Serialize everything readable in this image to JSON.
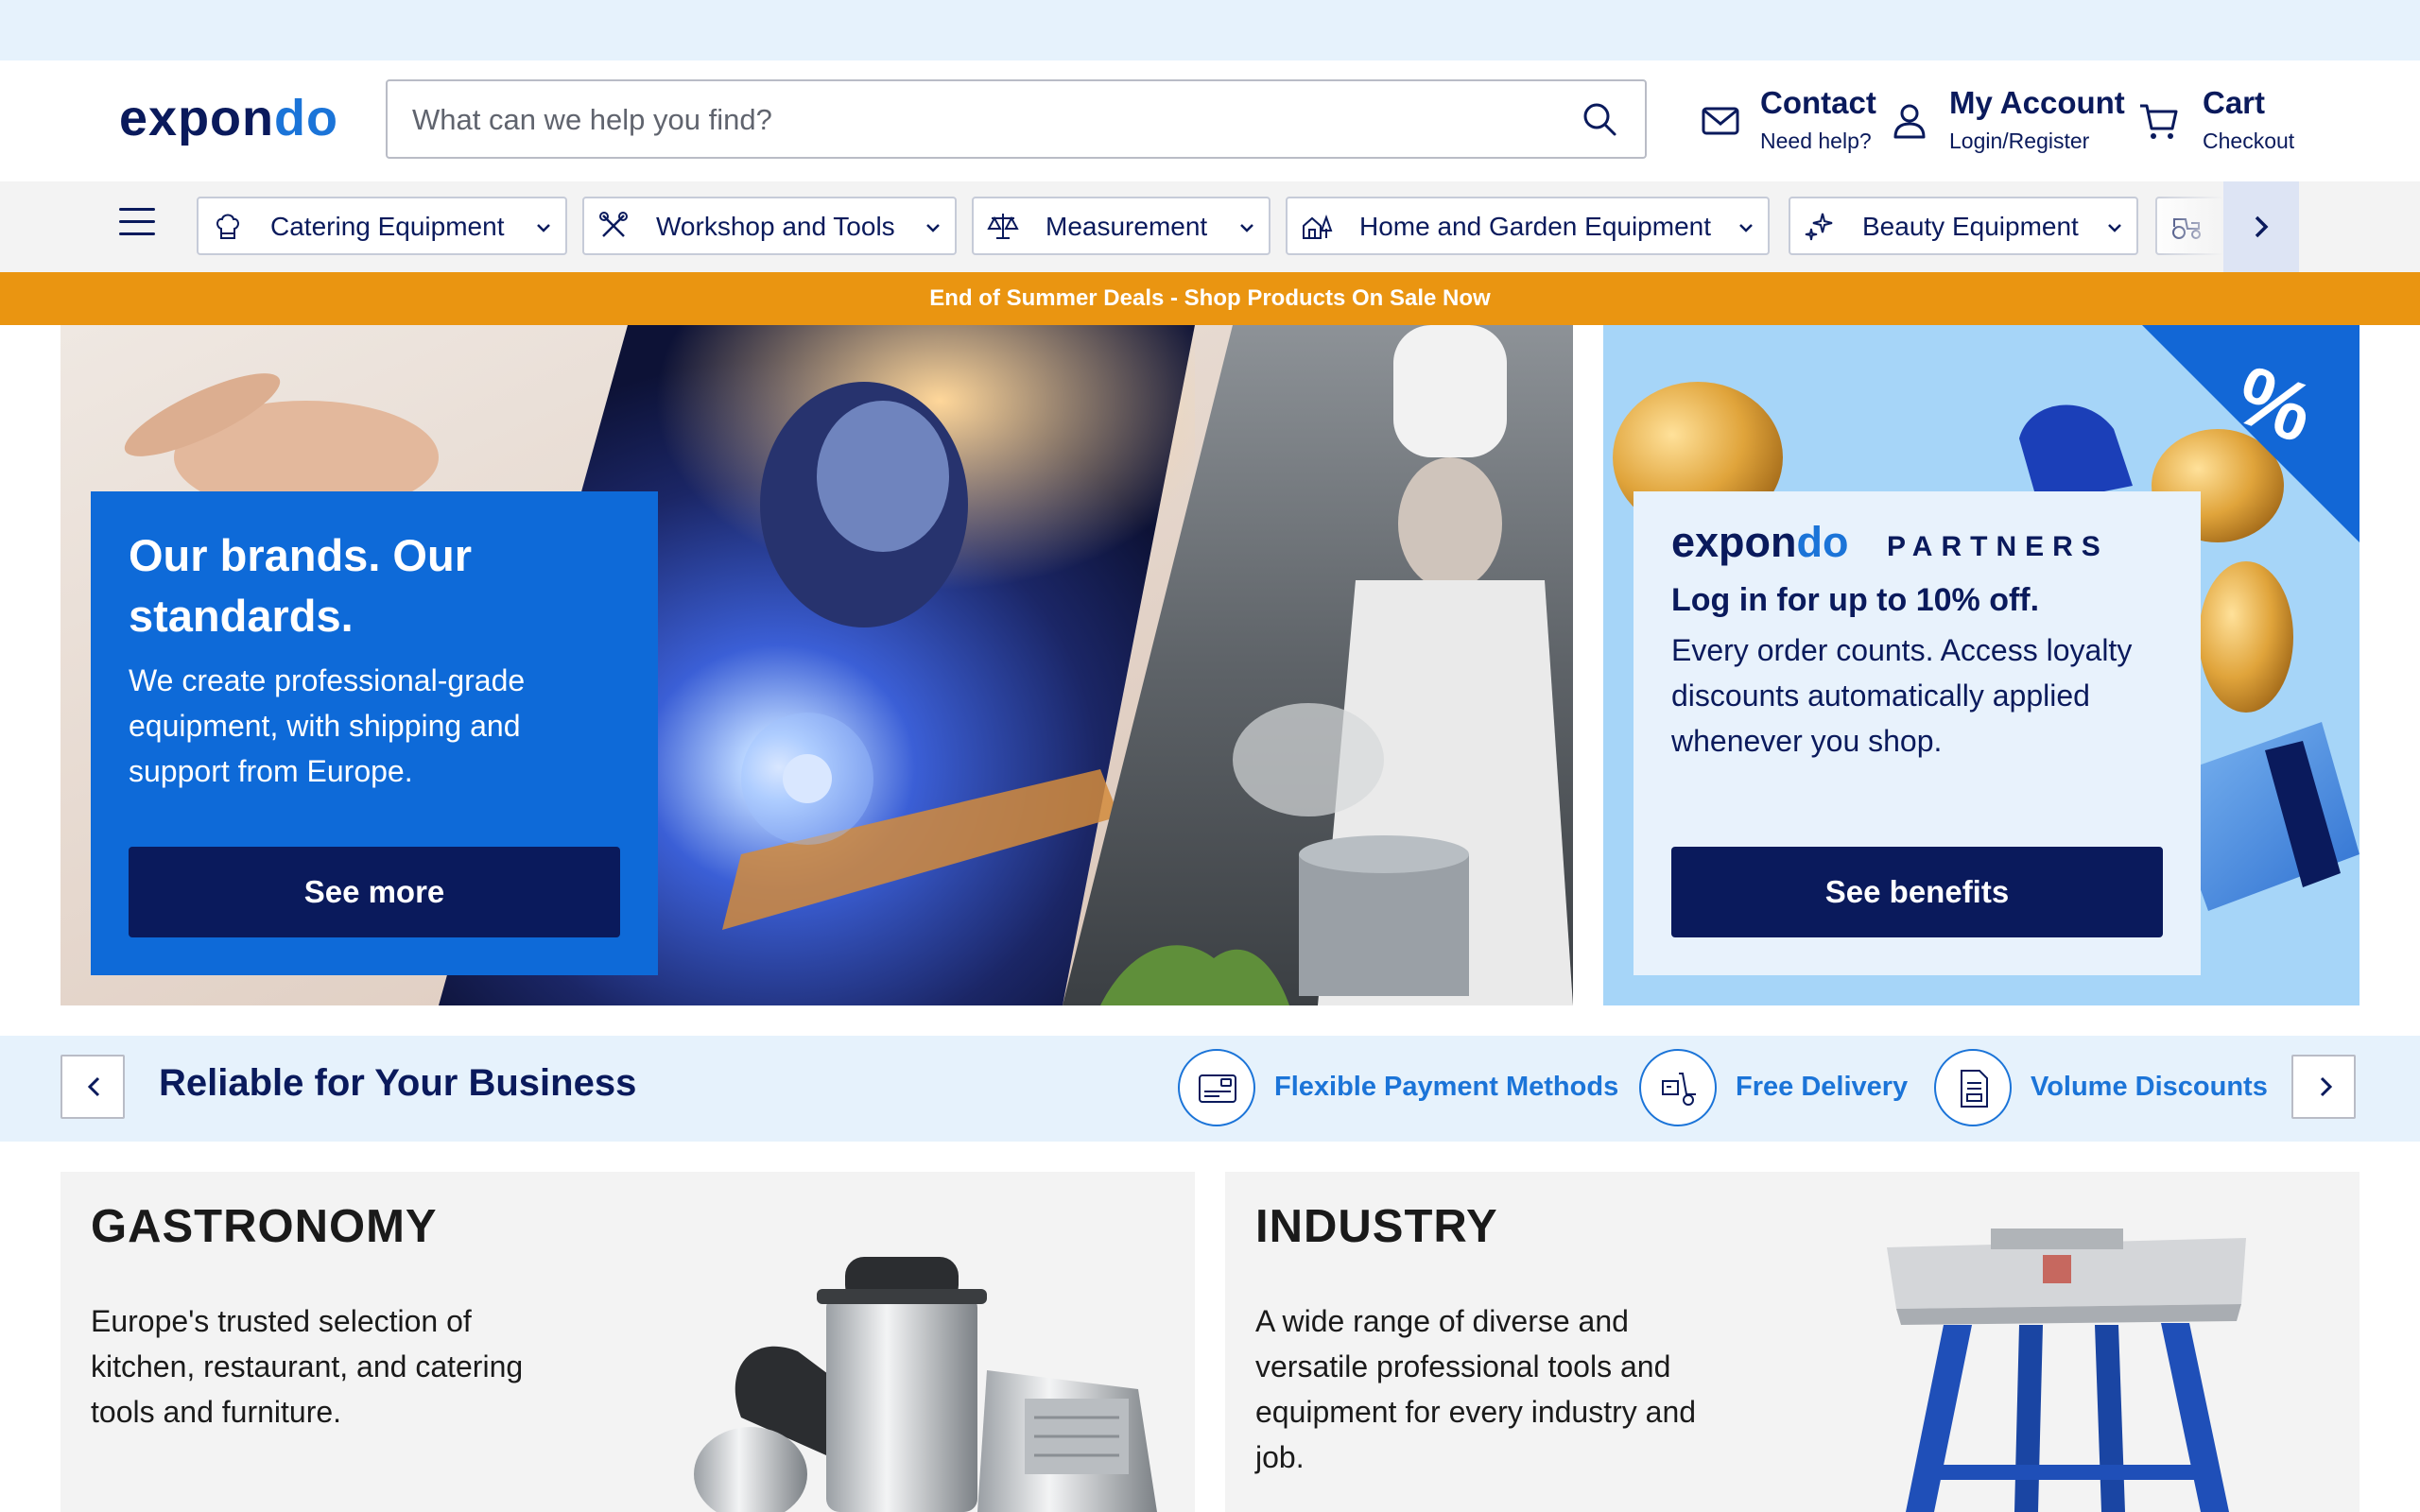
{
  "logo": {
    "part1": "expon",
    "part2": "do"
  },
  "search": {
    "placeholder": "What can we help you find?"
  },
  "header": {
    "contact": {
      "title": "Contact",
      "subtitle": "Need help?"
    },
    "account": {
      "title": "My Account",
      "subtitle": "Login/Register"
    },
    "cart": {
      "title": "Cart",
      "subtitle": "Checkout"
    }
  },
  "nav": {
    "categories": [
      {
        "label": "Catering Equipment",
        "icon": "chef-hat-icon"
      },
      {
        "label": "Workshop and Tools",
        "icon": "tools-icon"
      },
      {
        "label": "Measurement",
        "icon": "scale-icon"
      },
      {
        "label": "Home and Garden Equipment",
        "icon": "house-tree-icon"
      },
      {
        "label": "Beauty Equipment",
        "icon": "sparkle-icon"
      },
      {
        "label": "",
        "icon": "tractor-icon"
      }
    ]
  },
  "promo": {
    "text": "End of Summer Deals - Shop Products On Sale Now"
  },
  "hero": {
    "title": "Our brands. Our standards.",
    "text": "We create professional-grade equipment, with shipping and support from Europe.",
    "button": "See more"
  },
  "partners": {
    "logo_part1": "expon",
    "logo_part2": "do",
    "word": "PARTNERS",
    "badge": "%",
    "title": "Log in for up to 10% off.",
    "text": "Every order counts. Access loyalty discounts automatically applied whenever you shop.",
    "button": "See benefits"
  },
  "benefits": {
    "title": "Reliable for Your Business",
    "items": [
      {
        "label": "Flexible Payment Methods",
        "icon": "credit-card-icon"
      },
      {
        "label": "Free Delivery",
        "icon": "delivery-trolley-icon"
      },
      {
        "label": "Volume Discounts",
        "icon": "document-discount-icon"
      }
    ]
  },
  "categories": [
    {
      "title": "GASTRONOMY",
      "text": "Europe's trusted selection of kitchen, restaurant, and catering tools and furniture."
    },
    {
      "title": "INDUSTRY",
      "text": "A wide range of diverse and versatile professional tools and equipment for every industry and job."
    }
  ],
  "colors": {
    "brand_navy": "#0a1a5c",
    "brand_blue": "#1b74d8",
    "promo_orange": "#ea9511",
    "light_blue_bg": "#e6f2fc"
  }
}
